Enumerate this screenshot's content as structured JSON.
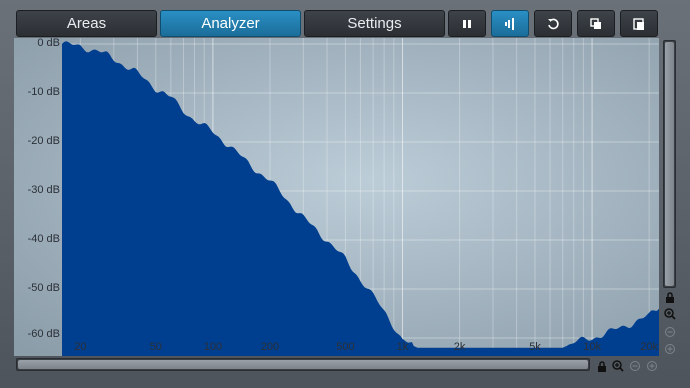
{
  "toolbar": {
    "areas_label": "Areas",
    "analyzer_label": "Analyzer",
    "settings_label": "Settings",
    "icons": [
      "pause-icon",
      "freeze-icon",
      "reset-icon",
      "copy-icon",
      "paste-icon"
    ]
  },
  "y_axis": {
    "labels": [
      "0 dB",
      "-10 dB",
      "-20 dB",
      "-30 dB",
      "-40 dB",
      "-50 dB",
      "-60 dB"
    ]
  },
  "x_axis": {
    "labels": [
      "20",
      "50",
      "100",
      "200",
      "500",
      "1k",
      "2k",
      "5k",
      "10k",
      "20k"
    ]
  },
  "colors": {
    "spectrum_fill": "#003f8f",
    "accent": "#2a8fc4",
    "plot_bg_center": "#b9cad6",
    "plot_bg_edge": "#8e9fac"
  },
  "chart_data": {
    "type": "area",
    "xlabel": "",
    "ylabel": "",
    "x_scale": "log",
    "xlim": [
      16,
      22000
    ],
    "ylim": [
      -62,
      0
    ],
    "x": [
      16,
      20,
      25,
      30,
      40,
      50,
      60,
      70,
      80,
      100,
      120,
      150,
      200,
      250,
      300,
      400,
      500,
      600,
      700,
      800,
      900,
      1000,
      1200,
      1500,
      2000,
      3000,
      5000,
      7000,
      8000,
      10000,
      12000,
      15000,
      20000,
      22000
    ],
    "values": [
      0,
      -0.5,
      -1.5,
      -3,
      -6,
      -9,
      -11,
      -13.5,
      -15.5,
      -18,
      -20.5,
      -24,
      -28,
      -32,
      -35.5,
      -40,
      -44,
      -48,
      -51.5,
      -54.5,
      -57.5,
      -60.5,
      -62,
      -62,
      -62,
      -62,
      -62,
      -62,
      -61,
      -60,
      -59,
      -57.5,
      -55.5,
      -54
    ]
  }
}
